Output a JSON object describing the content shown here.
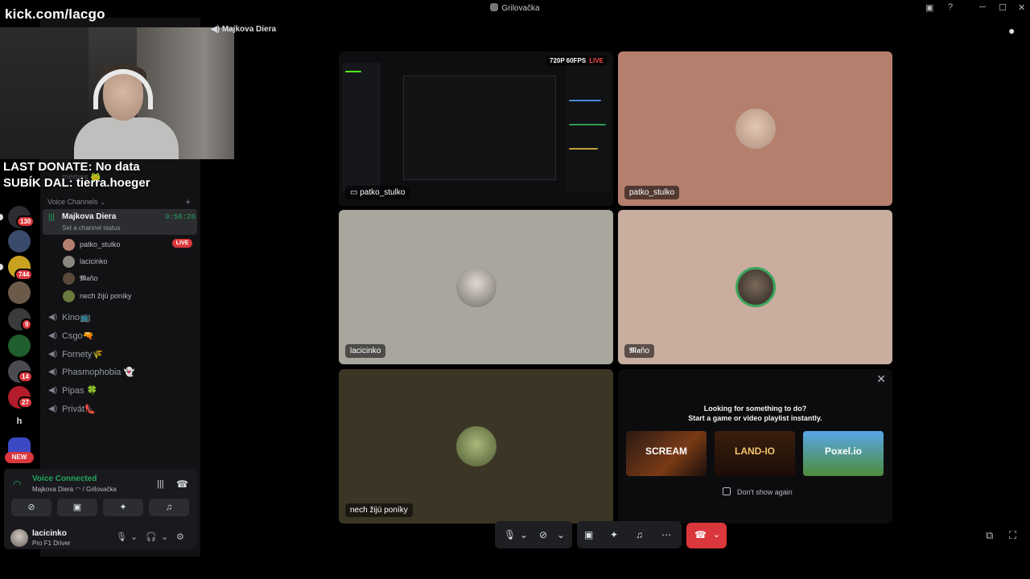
{
  "window": {
    "title": "Grilovačka",
    "controls": [
      "─",
      "☐",
      "✕"
    ]
  },
  "overlay": {
    "url": "kick.com/lacgo",
    "last_donate": "LAST DONATE: No data",
    "sub": "SUBÍK DAL: tierra.hoeger"
  },
  "servers": {
    "badges": [
      "130",
      "744",
      "9",
      "14",
      "27"
    ],
    "letter": "h",
    "new_label": "NEW"
  },
  "channels": {
    "faded_text": "memes 🐸",
    "voice_header": "Voice Channels",
    "active": {
      "name": "Majkova Diera",
      "timer": "9:56:26",
      "status": "Set a channel status"
    },
    "members": [
      {
        "name": "patko_stulko",
        "live": "LIVE"
      },
      {
        "name": "lacicinko"
      },
      {
        "name": "𝕸𝖆ňo"
      },
      {
        "name": "nech žijú poníky"
      }
    ],
    "others": [
      "Kino📺",
      "Csgo🔫",
      "Fornety🌾",
      "Phasmophobia 👻",
      "Pipas 🍀",
      "Privát👠"
    ]
  },
  "voice": {
    "connected": "Voice Connected",
    "location": "Majkova Diera ◠ / Grilovačka"
  },
  "user": {
    "name": "lacicinko",
    "status": "Pro F1 Driver"
  },
  "call": {
    "header": "Majkova Diera",
    "stream_quality": "720P 60FPS",
    "live": "LIVE",
    "tiles": [
      "patko_stulko",
      "patko_stulko",
      "lacicinko",
      "𝕸𝖆ňo",
      "nech žijú poníky"
    ]
  },
  "activity": {
    "line1": "Looking for something to do?",
    "line2": "Start a game or video playlist instantly.",
    "games": [
      "SCREAM",
      "LAND-IO",
      "Poxel.io"
    ],
    "dont_show": "Don't show again"
  },
  "colors": {
    "accent_green": "#23a55a",
    "danger": "#da373c",
    "tile_patko": "#b47f6d",
    "tile_lacicinko": "#a9a69d",
    "tile_mano": "#c9ad9f",
    "tile_nech": "#3b3526"
  }
}
